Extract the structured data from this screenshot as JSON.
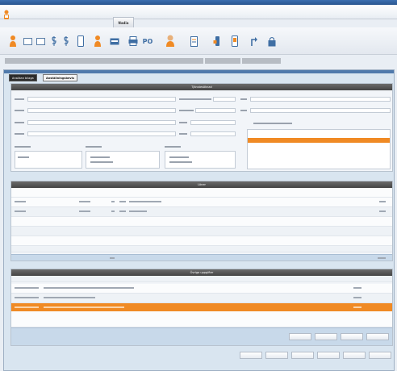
{
  "menu": {
    "tab_label": "Nadia"
  },
  "toolbar": {
    "buttons": [
      {
        "icon": "person-icon"
      },
      {
        "icon": "card-icon"
      },
      {
        "icon": "card2-icon"
      },
      {
        "icon": "dollar-icon"
      },
      {
        "icon": "dollar2-icon"
      },
      {
        "icon": "phone-icon"
      },
      {
        "icon": "person2-icon"
      },
      {
        "icon": "card3-icon"
      },
      {
        "icon": "printer-icon"
      },
      {
        "icon": "po-text-icon",
        "text": "PO"
      },
      {
        "icon": "person3-icon"
      },
      {
        "icon": "document-icon"
      },
      {
        "icon": "hand-icon"
      },
      {
        "icon": "phone2-icon"
      },
      {
        "icon": "arrow-icon"
      },
      {
        "icon": "lock-icon"
      }
    ]
  },
  "tabs": [
    {
      "label": "Ansökan bilaga"
    },
    {
      "label": "Anställningsbevis"
    }
  ],
  "sections": {
    "top_header": "Tjänstesöknad",
    "middle_header": "Löner",
    "bottom_header": "Övriga uppgifter"
  },
  "colors": {
    "accent": "#f08a24",
    "header": "#4a4a4a",
    "window": "#d9e5f0"
  }
}
